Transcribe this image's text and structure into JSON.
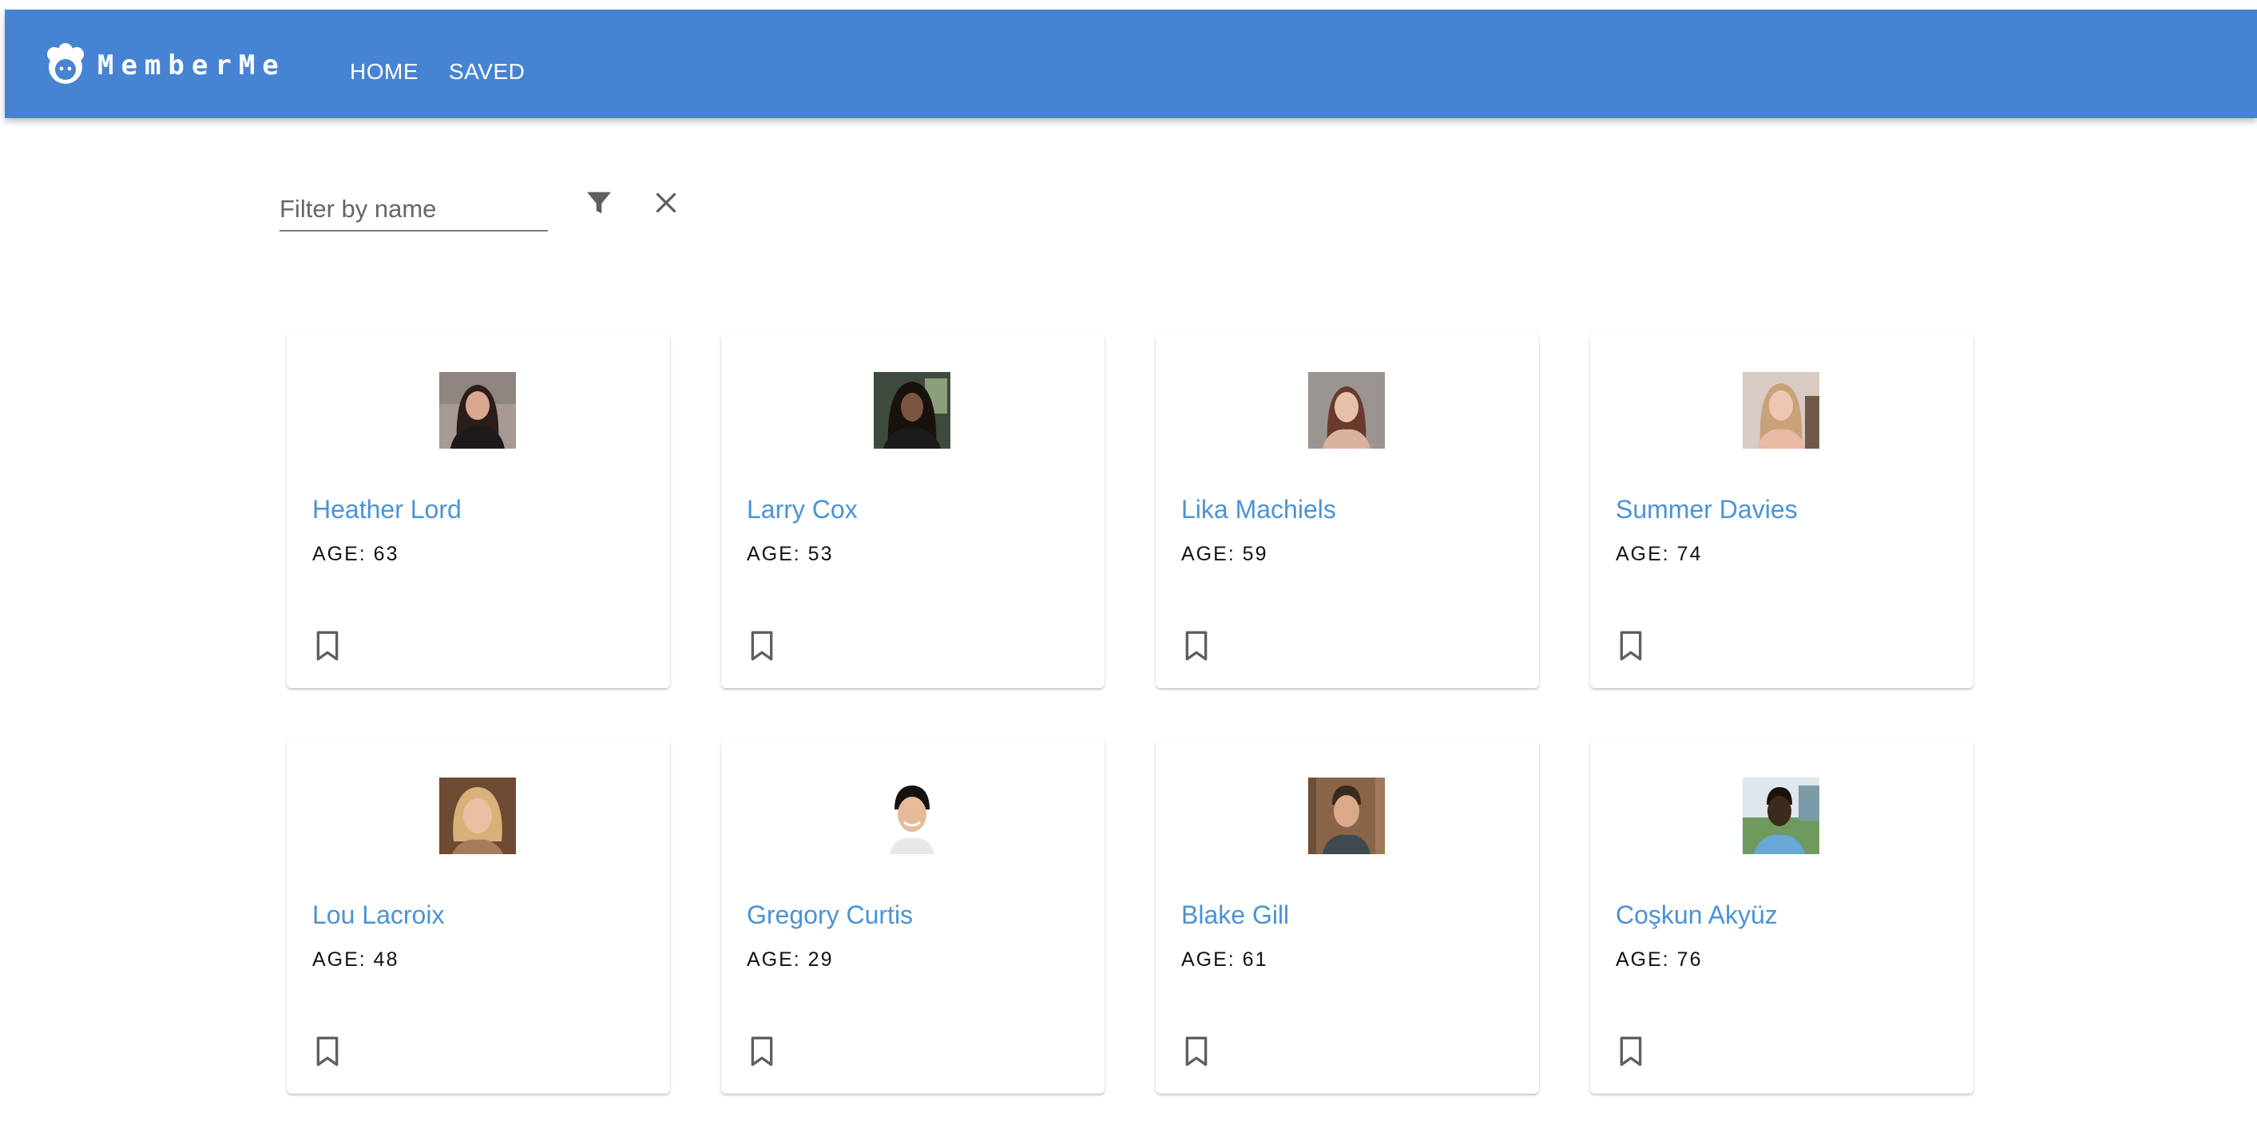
{
  "app": {
    "logo_text": "MemberMe",
    "brand_color": "#4683d3",
    "nav": [
      {
        "label": "HOME"
      },
      {
        "label": "SAVED"
      }
    ]
  },
  "filter": {
    "placeholder": "Filter by name",
    "value": "",
    "filter_icon": "filter-icon",
    "clear_icon": "close-icon"
  },
  "members": [
    {
      "name": "Heather Lord",
      "age": "AGE: 63"
    },
    {
      "name": "Larry Cox",
      "age": "AGE: 53"
    },
    {
      "name": "Lika Machiels",
      "age": "AGE: 59"
    },
    {
      "name": "Summer Davies",
      "age": "AGE: 74"
    },
    {
      "name": "Lou Lacroix",
      "age": "AGE: 48"
    },
    {
      "name": "Gregory Curtis",
      "age": "AGE: 29"
    },
    {
      "name": "Blake Gill",
      "age": "AGE: 61"
    },
    {
      "name": "Coşkun Akyüz",
      "age": "AGE: 76"
    }
  ],
  "colors": {
    "name_link": "#4a93d6",
    "icon": "#5f5f5f"
  }
}
